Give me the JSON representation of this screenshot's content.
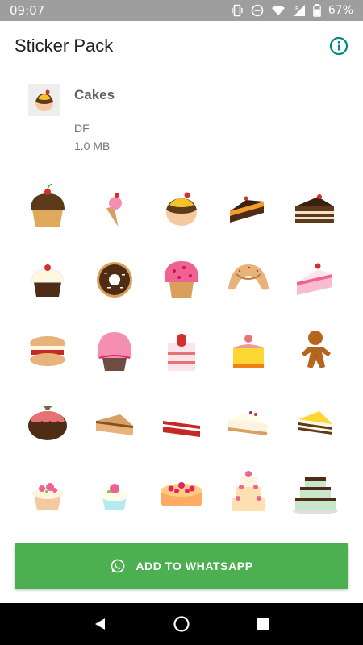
{
  "status_bar": {
    "time": "09:07",
    "battery": "67%",
    "icons": [
      "vibrate-icon",
      "do-not-disturb-icon",
      "wifi-icon",
      "signal-roaming-icon",
      "battery-icon"
    ]
  },
  "app_bar": {
    "title": "Sticker Pack",
    "info_icon": "info-icon"
  },
  "pack": {
    "name": "Cakes",
    "publisher": "DF",
    "size": "1.0 MB",
    "tray_icon": "cake-icon"
  },
  "stickers": [
    "cupcake-cherry",
    "ice-cream-cone",
    "frosted-bun",
    "chocolate-cake-slice",
    "layered-chocolate-slice",
    "cupcake-cherry-2",
    "chocolate-donut",
    "pink-muffin",
    "croissant",
    "strawberry-cake-slice",
    "macaron",
    "pink-cupcake",
    "strawberry-layer-cake",
    "fruit-tart",
    "gingerbread-man",
    "christmas-pudding",
    "caramel-cake-slice",
    "red-velvet-slice",
    "cheesecake-slice",
    "tiramisu-slice",
    "rose-cupcake",
    "mint-cupcake",
    "rose-cake",
    "tiered-rose-cake",
    "tiered-chocolate-cake"
  ],
  "add_button": {
    "label": "ADD TO WHATSAPP",
    "icon": "whatsapp-icon"
  },
  "nav_bar": {
    "buttons": [
      "back-icon",
      "home-icon",
      "recents-icon"
    ]
  },
  "colors": {
    "accent": "#4caf50",
    "info": "#00897b",
    "status_bar": "#9e9e9e"
  }
}
